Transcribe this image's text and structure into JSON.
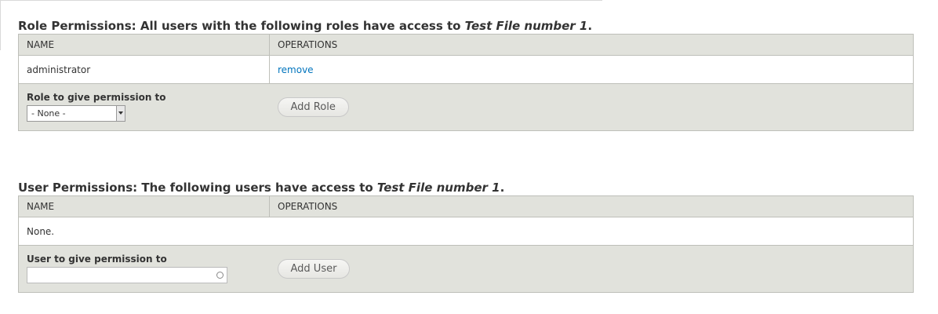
{
  "role_section": {
    "caption_prefix": "Role Permissions: All users with the following roles have access to ",
    "caption_item": "Test File number 1",
    "caption_suffix": ".",
    "columns": [
      "NAME",
      "OPERATIONS"
    ],
    "rows": [
      {
        "name": "administrator",
        "operation": "remove"
      }
    ],
    "form": {
      "label": "Role to give permission to",
      "select_value": "- None -",
      "button_label": "Add Role"
    }
  },
  "user_section": {
    "caption_prefix": "User Permissions: The following users have access to ",
    "caption_item": "Test File number 1",
    "caption_suffix": ".",
    "columns": [
      "NAME",
      "OPERATIONS"
    ],
    "empty_text": "None.",
    "form": {
      "label": "User to give permission to",
      "input_value": "",
      "button_label": "Add User"
    }
  },
  "colors": {
    "header_bg": "#e1e2dc",
    "border": "#bebfb9",
    "link": "#0074bd"
  }
}
